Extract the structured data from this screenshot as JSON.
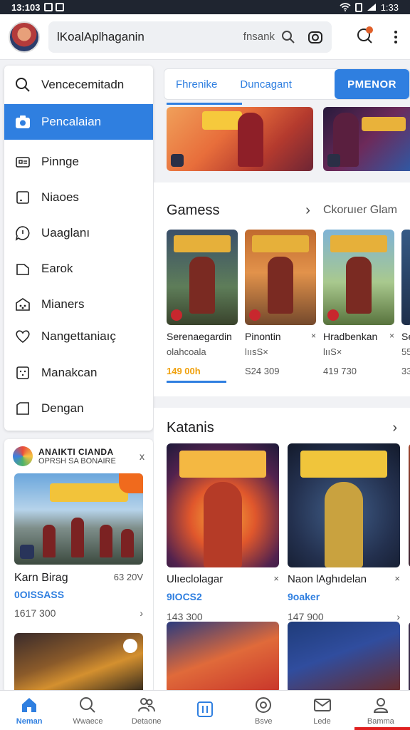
{
  "status_bar": {
    "time": "13:103",
    "right_time": "1:33"
  },
  "app_bar": {
    "search_query": "lKoalAplhaganin",
    "search_hint": "fnsank"
  },
  "side_menu": {
    "items": [
      {
        "label": "Vencecemitadn",
        "icon": "search-icon"
      },
      {
        "label": "Pencalaian",
        "icon": "camera-icon",
        "active": true
      },
      {
        "label": "Pinnge",
        "icon": "gallery-icon"
      },
      {
        "label": "Niaoes",
        "icon": "square-icon"
      },
      {
        "label": "Uaaglanı",
        "icon": "chat-icon"
      },
      {
        "label": "Earok",
        "icon": "folder-icon"
      },
      {
        "label": "Mianers",
        "icon": "gift-icon"
      },
      {
        "label": "Nangettaniaıç",
        "icon": "heart-icon"
      },
      {
        "label": "Manakcan",
        "icon": "grid-icon"
      },
      {
        "label": "Dengan",
        "icon": "square-icon"
      }
    ]
  },
  "left_card": {
    "title": "ANAIKTI CIANDA",
    "subtitle": "OPRSH SA BONAIRE",
    "close": "x",
    "item1": {
      "name": "Karn Birag",
      "side_price": "63 20V",
      "price": "0OISSASS",
      "downloads": "1617 300",
      "arrow": "›"
    }
  },
  "tabs": [
    {
      "label": "Fhrenike"
    },
    {
      "label": "Duncagant"
    },
    {
      "label": "PMENOR",
      "selected": true
    }
  ],
  "games_section": {
    "title": "Gamess",
    "link": "Ckoruıer Glam",
    "chevron": "›",
    "items": [
      {
        "name": "Serenaegardin",
        "side": "",
        "sub": "olahcoala",
        "price": "149 00h",
        "hot": true
      },
      {
        "name": "Pinontin",
        "side": "×",
        "sub": "lıısS×",
        "price": "S24 309",
        "hot": false
      },
      {
        "name": "Hradbenkan",
        "side": "×",
        "sub": "lııS×",
        "price": "419 730",
        "hot": false
      },
      {
        "name": "Se",
        "side": "",
        "sub": "55",
        "price": "33",
        "hot": false
      }
    ]
  },
  "katanis_section": {
    "title": "Katanis",
    "chevron": "›",
    "items": [
      {
        "name": "Ulıeclolagar",
        "side": "×",
        "price": "9IOCS2",
        "downloads": "143 300",
        "arrow": ""
      },
      {
        "name": "Naon lAghıdelan",
        "side": "×",
        "price": "9oaker",
        "downloads": "147 900",
        "arrow": "›"
      }
    ]
  },
  "bottom_nav": {
    "items": [
      {
        "label": "Neman",
        "icon": "home-icon",
        "active": true
      },
      {
        "label": "Wwaece",
        "icon": "search-icon"
      },
      {
        "label": "Detaone",
        "icon": "people-icon"
      },
      {
        "label": "",
        "icon": "tablet-icon"
      },
      {
        "label": "Bsve",
        "icon": "record-icon"
      },
      {
        "label": "Lede",
        "icon": "mail-icon"
      },
      {
        "label": "Bamma",
        "icon": "account-icon"
      }
    ]
  },
  "colors": {
    "accent": "#2f7fe0",
    "price_hot": "#f0a10d",
    "status_bar": "#1f2530"
  }
}
